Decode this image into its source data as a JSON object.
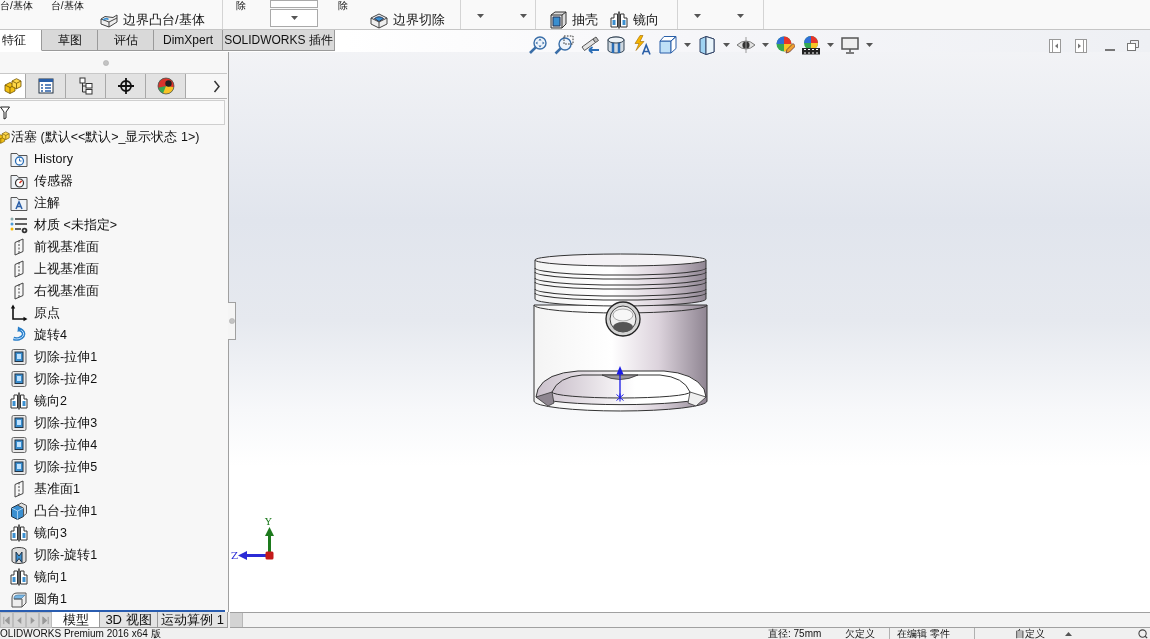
{
  "ribbon": {
    "groups": [
      {
        "kind": "commands",
        "cut_labels": [
          "台/基体",
          "台/基体"
        ],
        "commands": [
          {
            "label": "边界凸台/基体",
            "kind": "boundary-boss"
          }
        ]
      },
      {
        "kind": "cut-commands",
        "cut_labels": [
          "除",
          "除"
        ],
        "commands": [
          {
            "label": "边界切除",
            "kind": "boundary-cut"
          }
        ]
      },
      {
        "kind": "arrows"
      },
      {
        "kind": "commands",
        "commands": [
          {
            "label": "抽壳",
            "kind": "shell"
          },
          {
            "label": "镜向",
            "kind": "mirror"
          }
        ]
      },
      {
        "kind": "arrows"
      }
    ]
  },
  "command_tabs": [
    {
      "label": "特征",
      "selected": true
    },
    {
      "label": "草图",
      "selected": false
    },
    {
      "label": "评估",
      "selected": false
    },
    {
      "label": "DimXpert",
      "selected": false
    },
    {
      "label": "SOLIDWORKS 插件",
      "selected": false
    }
  ],
  "feature_panel": {
    "tabs": [
      {
        "kind": "feature-manager",
        "selected": true
      },
      {
        "kind": "property-manager",
        "selected": false
      },
      {
        "kind": "configuration-manager",
        "selected": false
      },
      {
        "kind": "dimxpert-manager",
        "selected": false
      },
      {
        "kind": "display-manager",
        "selected": false
      }
    ],
    "tree": {
      "label": "活塞 (默认<<默认>_显示状态 1>)",
      "kind": "part",
      "children": [
        {
          "label": "History",
          "kind": "history"
        },
        {
          "label": "传感器",
          "kind": "sensors"
        },
        {
          "label": "注解",
          "kind": "annotations"
        },
        {
          "label": "材质 <未指定>",
          "kind": "material"
        },
        {
          "label": "前视基准面",
          "kind": "plane"
        },
        {
          "label": "上视基准面",
          "kind": "plane"
        },
        {
          "label": "右视基准面",
          "kind": "plane"
        },
        {
          "label": "原点",
          "kind": "origin"
        },
        {
          "label": "旋转4",
          "kind": "revolve"
        },
        {
          "label": "切除-拉伸1",
          "kind": "cut-extrude"
        },
        {
          "label": "切除-拉伸2",
          "kind": "cut-extrude"
        },
        {
          "label": "镜向2",
          "kind": "mirror"
        },
        {
          "label": "切除-拉伸3",
          "kind": "cut-extrude"
        },
        {
          "label": "切除-拉伸4",
          "kind": "cut-extrude"
        },
        {
          "label": "切除-拉伸5",
          "kind": "cut-extrude"
        },
        {
          "label": "基准面1",
          "kind": "plane"
        },
        {
          "label": "凸台-拉伸1",
          "kind": "boss-extrude"
        },
        {
          "label": "镜向3",
          "kind": "mirror"
        },
        {
          "label": "切除-旋转1",
          "kind": "cut-revolve"
        },
        {
          "label": "镜向1",
          "kind": "mirror"
        },
        {
          "label": "圆角1",
          "kind": "fillet"
        }
      ]
    }
  },
  "viewport": {
    "triad": {
      "y_label": "Y",
      "z_label": "Z"
    }
  },
  "model_tabs": [
    {
      "label": "模型",
      "selected": true
    },
    {
      "label": "3D 视图",
      "selected": false
    },
    {
      "label": "运动算例 1",
      "selected": false
    }
  ],
  "status_bar": {
    "product": "OLIDWORKS Premium 2016 x64 版",
    "fields": [
      "直径: 75mm",
      "欠定义",
      "在编辑 零件",
      "自定义"
    ]
  }
}
